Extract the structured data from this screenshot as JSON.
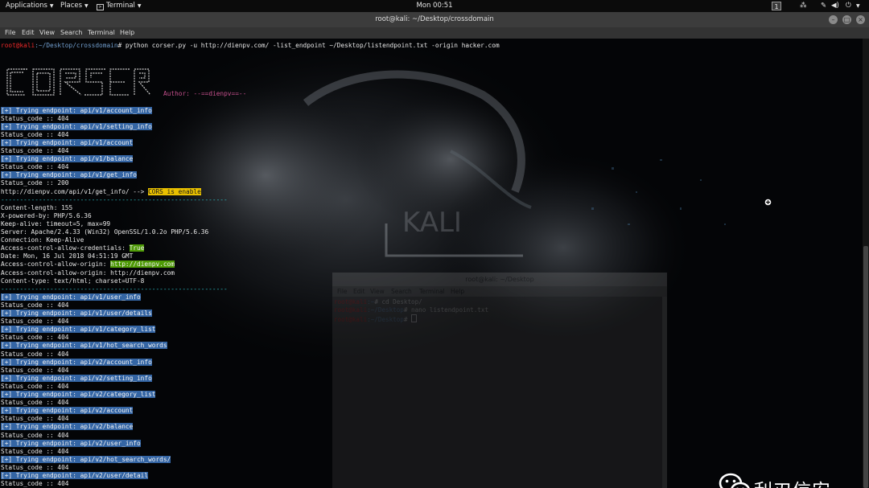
{
  "topbar": {
    "applications": "Applications",
    "places": "Places",
    "terminal": "Terminal",
    "clock": "Mon 00:51",
    "workspace": "1"
  },
  "window": {
    "title": "root@kali: ~/Desktop/crossdomain",
    "menu": [
      "File",
      "Edit",
      "View",
      "Search",
      "Terminal",
      "Help"
    ]
  },
  "terminal": {
    "prompt_user": "root@kali",
    "prompt_path": ":~/Desktop/crossdomain",
    "prompt_cmd": "# python corser.py -u http://dienpv.com/ -list_endpoint ~/Desktop/listendpoint.txt -origin hacker.com",
    "author": "Author: --==dienpv==--",
    "lines": [
      {
        "text": "[+] Trying endpoint: api/v1/account_info",
        "style": "hl"
      },
      {
        "text": "Status_code :: 404",
        "style": ""
      },
      {
        "text": "[+] Trying endpoint: api/v1/setting_info",
        "style": "hl"
      },
      {
        "text": "Status_code :: 404",
        "style": ""
      },
      {
        "text": "[+] Trying endpoint: api/v1/account",
        "style": "hl"
      },
      {
        "text": "Status_code :: 404",
        "style": ""
      },
      {
        "text": "[+] Trying endpoint: api/v1/balance",
        "style": "hl"
      },
      {
        "text": "Status_code :: 404",
        "style": ""
      },
      {
        "text": "[+] Trying endpoint: api/v1/get_info",
        "style": "hl"
      },
      {
        "text": "Status_code :: 200",
        "style": ""
      },
      {
        "text": "http://dienpv.com/api/v1/get_info/ --> ",
        "style": "",
        "badge": "CORS is enable",
        "badge_style": "yel"
      },
      {
        "text": "------------------------------------------------------------",
        "style": "dash"
      },
      {
        "text": "Content-length: 155",
        "style": ""
      },
      {
        "text": "X-powered-by: PHP/5.6.36",
        "style": ""
      },
      {
        "text": "Keep-alive: timeout=5, max=99",
        "style": ""
      },
      {
        "text": "Server: Apache/2.4.33 (Win32) OpenSSL/1.0.2o PHP/5.6.36",
        "style": ""
      },
      {
        "text": "Connection: Keep-Alive",
        "style": ""
      },
      {
        "text": "Access-control-allow-credentials: ",
        "style": "",
        "badge": "True",
        "badge_style": "grn"
      },
      {
        "text": "Date: Mon, 16 Jul 2018 04:51:19 GMT",
        "style": ""
      },
      {
        "text": "Access-control-allow-origin: ",
        "style": "",
        "badge": "http://dienpv.com",
        "badge_style": "grn"
      },
      {
        "text": "Access-control-allow-origin: http://dienpv.com",
        "style": ""
      },
      {
        "text": "Content-type: text/html; charset=UTF-8",
        "style": ""
      },
      {
        "text": "------------------------------------------------------------",
        "style": "dash"
      },
      {
        "text": "[+] Trying endpoint: api/v1/user_info",
        "style": "hl"
      },
      {
        "text": "Status_code :: 404",
        "style": ""
      },
      {
        "text": "[+] Trying endpoint: api/v1/user/details",
        "style": "hl"
      },
      {
        "text": "Status_code :: 404",
        "style": ""
      },
      {
        "text": "[+] Trying endpoint: api/v1/category_list",
        "style": "hl"
      },
      {
        "text": "Status_code :: 404",
        "style": ""
      },
      {
        "text": "[+] Trying endpoint: api/v1/hot_search_words",
        "style": "hl"
      },
      {
        "text": "Status_code :: 404",
        "style": ""
      },
      {
        "text": "[+] Trying endpoint: api/v2/account_info",
        "style": "hl"
      },
      {
        "text": "Status_code :: 404",
        "style": ""
      },
      {
        "text": "[+] Trying endpoint: api/v2/setting_info",
        "style": "hl"
      },
      {
        "text": "Status_code :: 404",
        "style": ""
      },
      {
        "text": "[+] Trying endpoint: api/v2/category_list",
        "style": "hl"
      },
      {
        "text": "Status_code :: 404",
        "style": ""
      },
      {
        "text": "[+] Trying endpoint: api/v2/account",
        "style": "hl"
      },
      {
        "text": "Status_code :: 404",
        "style": ""
      },
      {
        "text": "[+] Trying endpoint: api/v2/balance",
        "style": "hl"
      },
      {
        "text": "Status_code :: 404",
        "style": ""
      },
      {
        "text": "[+] Trying endpoint: api/v2/user_info",
        "style": "hl"
      },
      {
        "text": "Status_code :: 404",
        "style": ""
      },
      {
        "text": "[+] Trying endpoint: api/v2/hot_search_words/",
        "style": "hl"
      },
      {
        "text": "Status_code :: 404",
        "style": ""
      },
      {
        "text": "[+] Trying endpoint: api/v2/user/detail",
        "style": "hl"
      },
      {
        "text": "Status_code :: 404",
        "style": ""
      }
    ]
  },
  "background_terminal": {
    "title": "root@kali: ~/Desktop",
    "menu": [
      "File",
      "Edit",
      "View",
      "Search",
      "Terminal",
      "Help"
    ],
    "lines": [
      {
        "user": "root@kali",
        "path": ":~",
        "cmd": "# cd Desktop/"
      },
      {
        "user": "root@kali",
        "path": ":~/Desktop",
        "cmd": "# nano listendpoint.txt"
      },
      {
        "user": "root@kali",
        "path": ":~/Desktop",
        "cmd": "# "
      }
    ]
  },
  "watermark": {
    "text": "利刃信安",
    "icon": "wechat-icon"
  },
  "colors": {
    "highlight": "#3465a4",
    "cors_badge": "#e9c000",
    "true_badge": "#4e9a06",
    "prompt_user": "#ef2929",
    "prompt_path": "#729fcf",
    "separator": "#2ec0c6",
    "author": "#c7508e"
  }
}
